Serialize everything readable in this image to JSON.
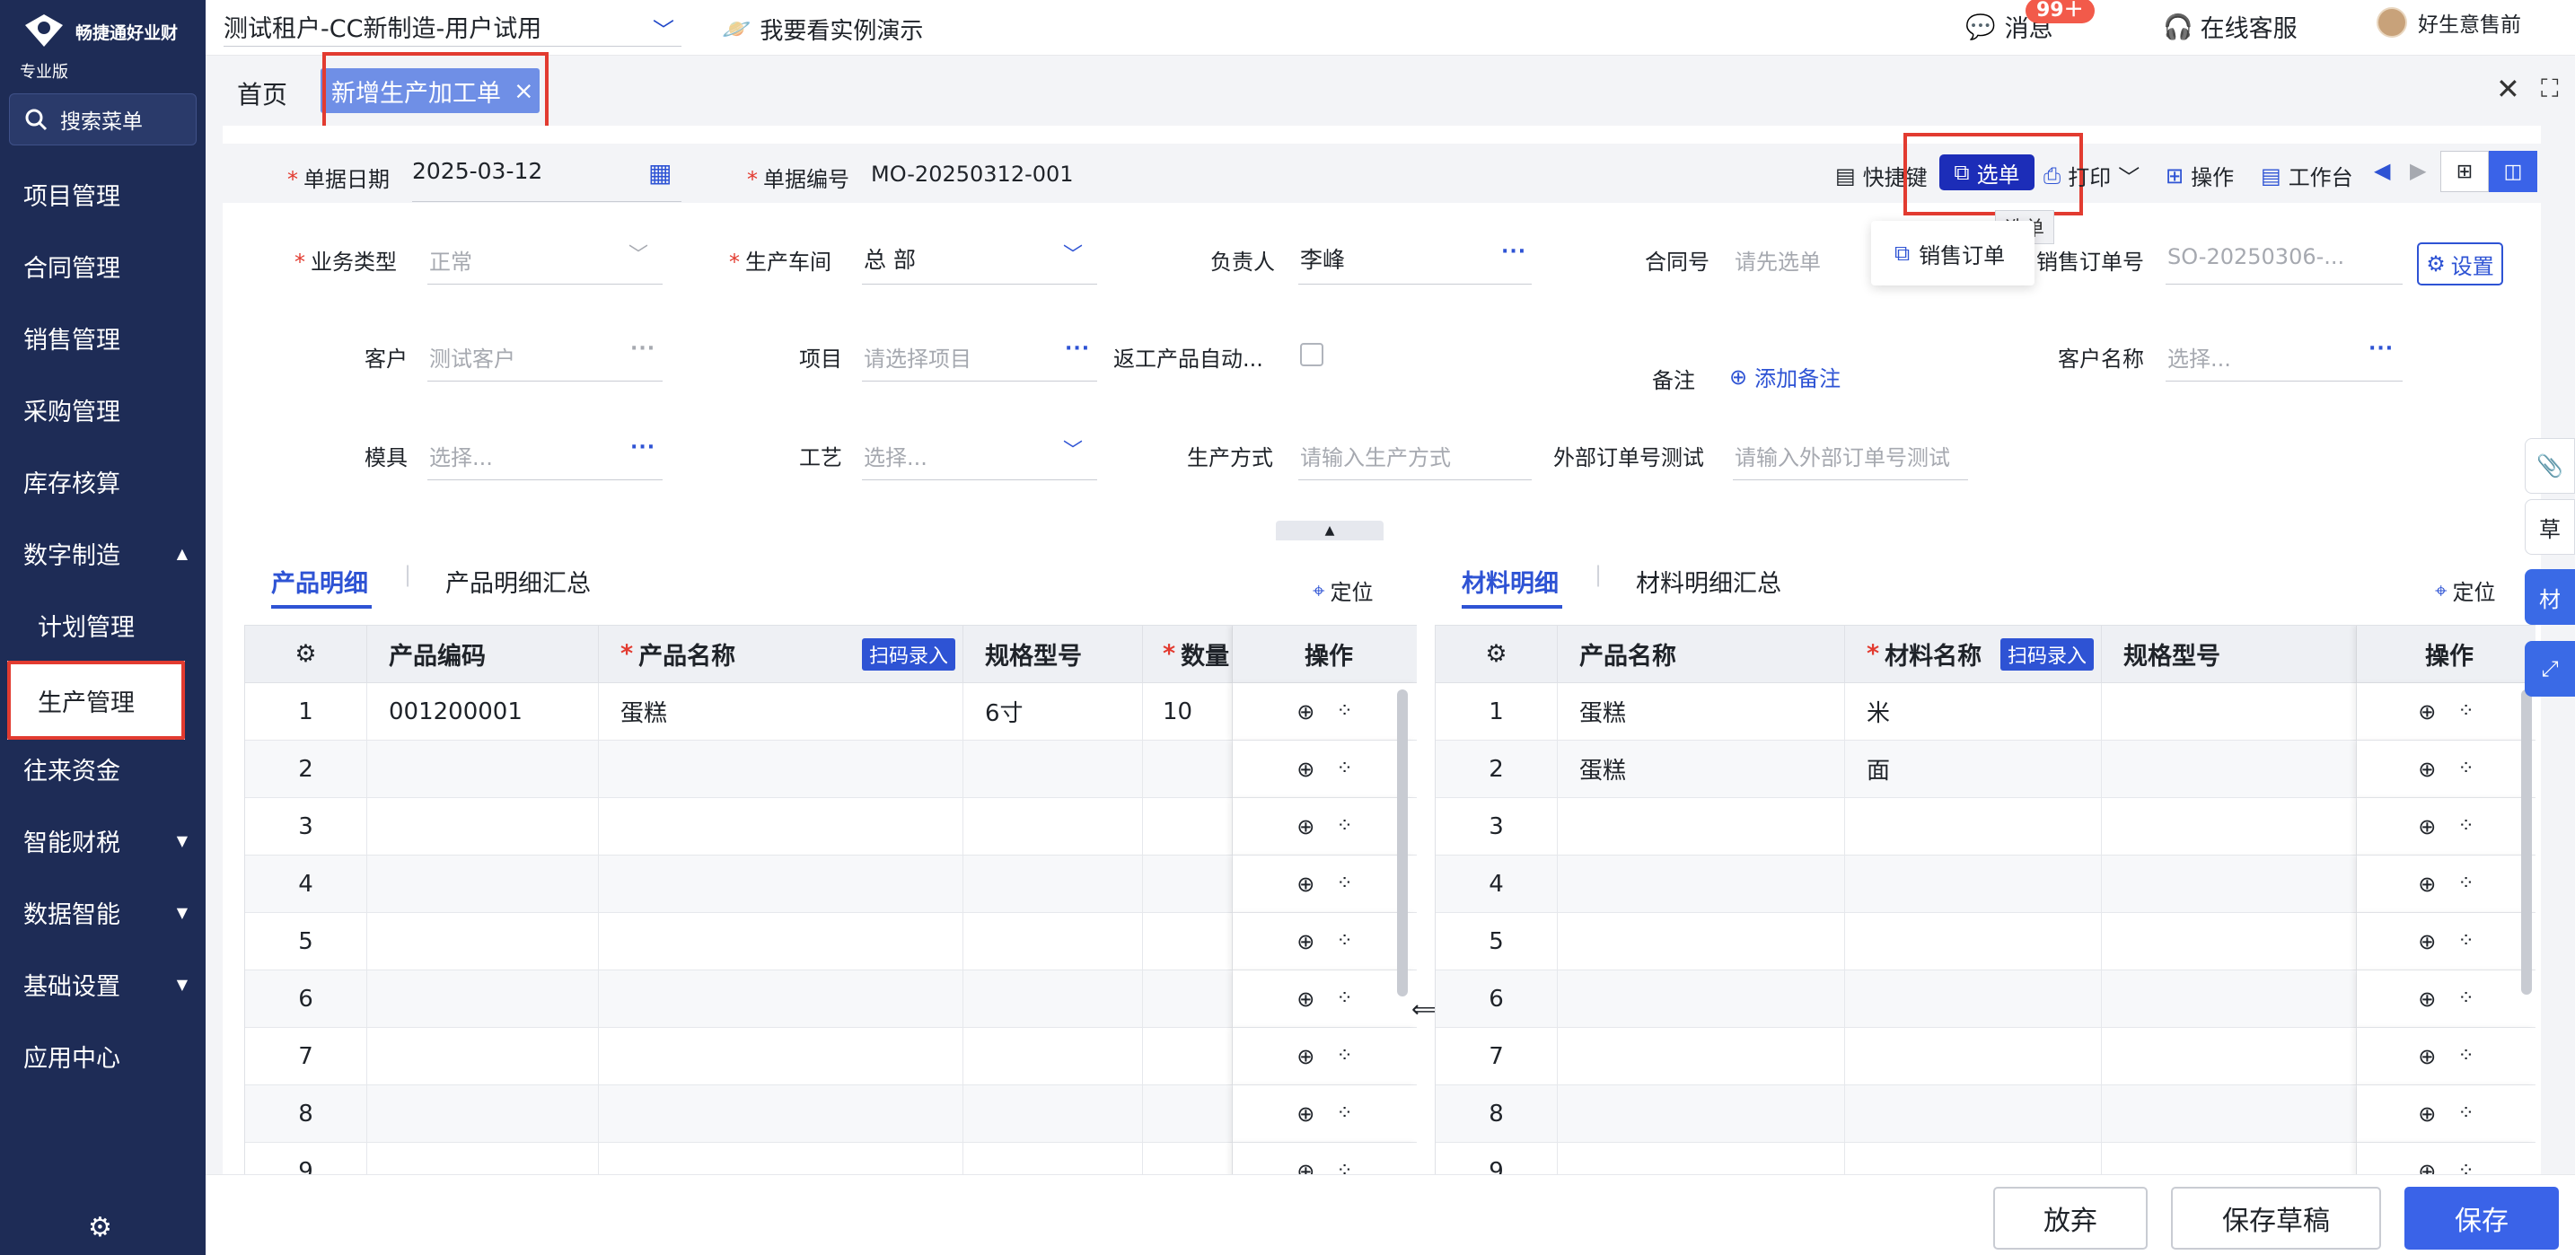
{
  "brand": {
    "name": "畅捷通好业财",
    "edition": "专业版"
  },
  "search": {
    "label": "搜索菜单"
  },
  "sidebar": {
    "items": [
      {
        "label": "项目管理"
      },
      {
        "label": "合同管理"
      },
      {
        "label": "销售管理"
      },
      {
        "label": "采购管理"
      },
      {
        "label": "库存核算"
      },
      {
        "label": "数字制造"
      },
      {
        "label": "计划管理"
      },
      {
        "label": "生产管理"
      },
      {
        "label": "往来资金"
      },
      {
        "label": "智能财税"
      },
      {
        "label": "数据智能"
      },
      {
        "label": "基础设置"
      },
      {
        "label": "应用中心"
      }
    ]
  },
  "topbar": {
    "tenant": "测试租户-CC新制造-用户试用",
    "demo": "我要看实例演示",
    "messages": "消息",
    "badge": "99＋",
    "support": "在线客服",
    "user": "好生意售前"
  },
  "tabs": {
    "home": "首页",
    "active": "新增生产加工单"
  },
  "toolbar": {
    "date_label": "单据日期",
    "date_value": "2025-03-12",
    "code_label": "单据编号",
    "code_value": "MO-20250312-001",
    "shortcut": "快捷键",
    "select": "选单",
    "print": "打印",
    "ops": "操作",
    "workbench": "工作台",
    "tooltip": "选单",
    "dropdown_item": "销售订单"
  },
  "form": {
    "biz_type_label": "业务类型",
    "biz_type_value": "正常",
    "workshop_label": "生产车间",
    "workshop_value": "总 部",
    "owner_label": "负责人",
    "owner_value": "李峰",
    "contract_label": "合同号",
    "contract_ph": "请先选单",
    "so_label": "销售订单号",
    "so_value": "SO-20250306-...",
    "settings": "设置",
    "customer_label": "客户",
    "customer_value": "测试客户",
    "project_label": "项目",
    "project_ph": "请选择项目",
    "rework_label": "返工产品自动...",
    "remark_label": "备注",
    "remark_add": "添加备注",
    "custname_label": "客户名称",
    "custname_ph": "选择...",
    "mold_label": "模具",
    "mold_ph": "选择...",
    "craft_label": "工艺",
    "craft_ph": "选择...",
    "method_label": "生产方式",
    "method_ph": "请输入生产方式",
    "ext_label": "外部订单号测试",
    "ext_ph": "请输入外部订单号测试"
  },
  "product": {
    "tab1": "产品明细",
    "tab2": "产品明细汇总",
    "locate": "定位",
    "headers": [
      "产品编码",
      "产品名称",
      "规格型号",
      "数量",
      "操作"
    ],
    "scan": "扫码录入",
    "rows": [
      {
        "no": "1",
        "code": "001200001",
        "name": "蛋糕",
        "spec": "6寸",
        "qty": "10"
      },
      {
        "no": "2"
      },
      {
        "no": "3"
      },
      {
        "no": "4"
      },
      {
        "no": "5"
      },
      {
        "no": "6"
      },
      {
        "no": "7"
      },
      {
        "no": "8"
      },
      {
        "no": "9"
      }
    ]
  },
  "material": {
    "tab1": "材料明细",
    "tab2": "材料明细汇总",
    "locate": "定位",
    "headers": [
      "产品名称",
      "材料名称",
      "规格型号",
      "操作"
    ],
    "scan": "扫码录入",
    "rows": [
      {
        "no": "1",
        "product": "蛋糕",
        "material": "米"
      },
      {
        "no": "2",
        "product": "蛋糕",
        "material": "面"
      },
      {
        "no": "3"
      },
      {
        "no": "4"
      },
      {
        "no": "5"
      },
      {
        "no": "6"
      },
      {
        "no": "7"
      },
      {
        "no": "8"
      },
      {
        "no": "9"
      }
    ]
  },
  "right_tabs": [
    "草",
    "材"
  ],
  "footer": {
    "discard": "放弃",
    "draft": "保存草稿",
    "save": "保存"
  }
}
